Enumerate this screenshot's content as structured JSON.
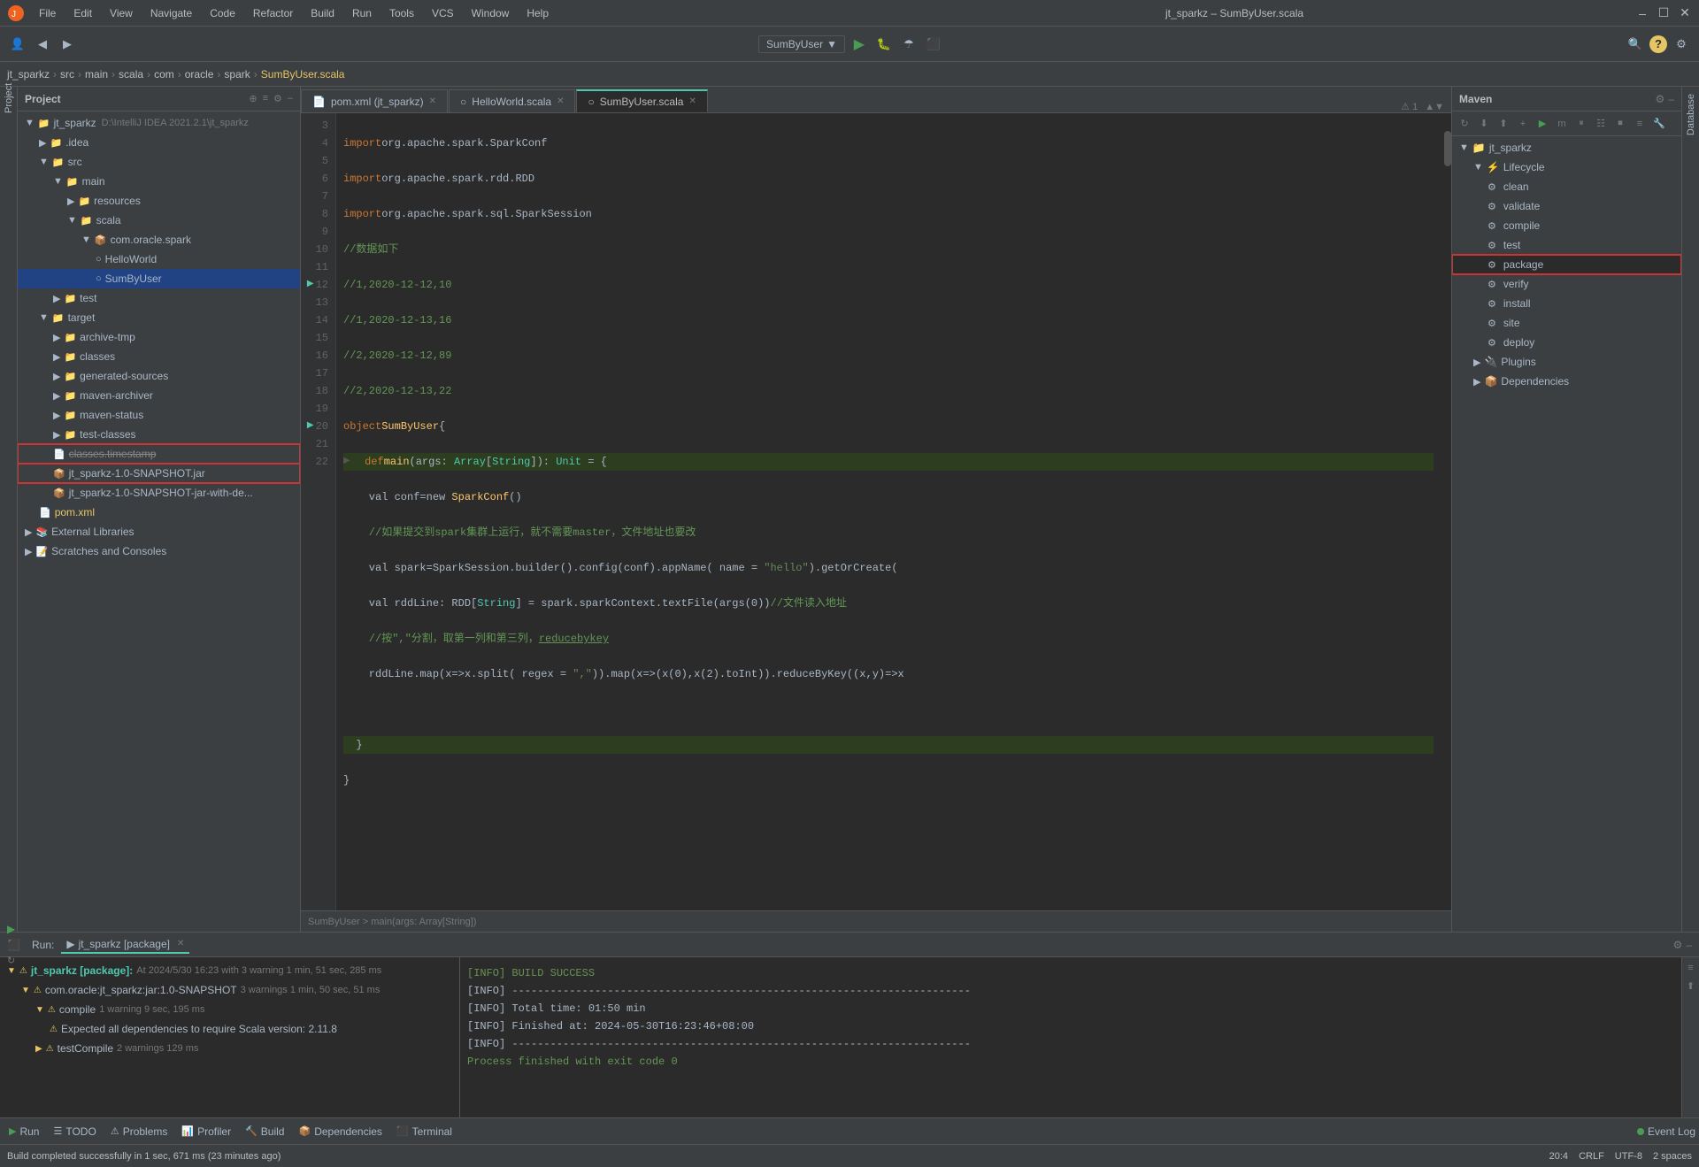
{
  "titlebar": {
    "menus": [
      "File",
      "Edit",
      "View",
      "Navigate",
      "Code",
      "Refactor",
      "Build",
      "Run",
      "Tools",
      "VCS",
      "Window",
      "Help"
    ],
    "title": "jt_sparkz – SumByUser.scala",
    "controls": [
      "–",
      "☐",
      "✕"
    ]
  },
  "breadcrumb": {
    "items": [
      "jt_sparkz",
      "src",
      "main",
      "scala",
      "com",
      "oracle",
      "spark",
      "SumByUser.scala"
    ]
  },
  "toolbar": {
    "profile_label": "SumByUser",
    "run_icon": "▶",
    "debug_icon": "🐛"
  },
  "project": {
    "header": "Project",
    "tree": [
      {
        "indent": 0,
        "icon": "▼",
        "name": "jt_sparkz",
        "extra": "D:\\IntelliJ IDEA 2021.2.1\\jt_sparkz",
        "type": "folder",
        "color": "normal"
      },
      {
        "indent": 1,
        "icon": "▶",
        "name": ".idea",
        "type": "folder",
        "color": "normal"
      },
      {
        "indent": 1,
        "icon": "▼",
        "name": "src",
        "type": "folder",
        "color": "normal"
      },
      {
        "indent": 2,
        "icon": "▼",
        "name": "main",
        "type": "folder",
        "color": "normal"
      },
      {
        "indent": 3,
        "icon": "▶",
        "name": "resources",
        "type": "folder",
        "color": "normal"
      },
      {
        "indent": 3,
        "icon": "▼",
        "name": "scala",
        "type": "folder",
        "color": "normal"
      },
      {
        "indent": 4,
        "icon": "▼",
        "name": "com.oracle.spark",
        "type": "package",
        "color": "normal"
      },
      {
        "indent": 5,
        "icon": "○",
        "name": "HelloWorld",
        "type": "scala",
        "color": "normal"
      },
      {
        "indent": 5,
        "icon": "○",
        "name": "SumByUser",
        "type": "scala",
        "color": "selected"
      },
      {
        "indent": 2,
        "icon": "▶",
        "name": "test",
        "type": "folder",
        "color": "normal"
      },
      {
        "indent": 1,
        "icon": "▼",
        "name": "target",
        "type": "folder",
        "color": "normal"
      },
      {
        "indent": 2,
        "icon": "▶",
        "name": "archive-tmp",
        "type": "folder",
        "color": "normal"
      },
      {
        "indent": 2,
        "icon": "▶",
        "name": "classes",
        "type": "folder",
        "color": "normal"
      },
      {
        "indent": 2,
        "icon": "▶",
        "name": "generated-sources",
        "type": "folder",
        "color": "normal"
      },
      {
        "indent": 2,
        "icon": "▶",
        "name": "maven-archiver",
        "type": "folder",
        "color": "normal"
      },
      {
        "indent": 2,
        "icon": "▶",
        "name": "maven-status",
        "type": "folder",
        "color": "normal"
      },
      {
        "indent": 2,
        "icon": "▶",
        "name": "test-classes",
        "type": "folder",
        "color": "normal"
      },
      {
        "indent": 2,
        "icon": "📄",
        "name": "classes.timestamp",
        "type": "file",
        "color": "strikethrough"
      },
      {
        "indent": 2,
        "icon": "📦",
        "name": "jt_sparkz-1.0-SNAPSHOT.jar",
        "type": "jar",
        "color": "normal",
        "highlight": true
      },
      {
        "indent": 2,
        "icon": "📦",
        "name": "jt_sparkz-1.0-SNAPSHOT-jar-with-de...",
        "type": "jar",
        "color": "normal"
      },
      {
        "indent": 1,
        "icon": "📄",
        "name": "pom.xml",
        "type": "file",
        "color": "normal"
      },
      {
        "indent": 0,
        "icon": "▶",
        "name": "External Libraries",
        "type": "folder",
        "color": "normal"
      },
      {
        "indent": 0,
        "icon": "▶",
        "name": "Scratches and Consoles",
        "type": "folder",
        "color": "normal"
      }
    ]
  },
  "tabs": [
    {
      "name": "pom.xml (jt_sparkz)",
      "active": false,
      "modified": false
    },
    {
      "name": "HelloWorld.scala",
      "active": false,
      "modified": false
    },
    {
      "name": "SumByUser.scala",
      "active": true,
      "modified": false
    }
  ],
  "code": {
    "lines": [
      {
        "num": 3,
        "text": "import org.apache.spark.SparkConf",
        "type": "import"
      },
      {
        "num": 4,
        "text": "import org.apache.spark.rdd.RDD",
        "type": "import"
      },
      {
        "num": 5,
        "text": "import org.apache.spark.sql.SparkSession",
        "type": "import"
      },
      {
        "num": 6,
        "text": "//数据如下",
        "type": "comment"
      },
      {
        "num": 7,
        "text": "//1,2020-12-12,10",
        "type": "comment"
      },
      {
        "num": 8,
        "text": "//1,2020-12-13,16",
        "type": "comment"
      },
      {
        "num": 9,
        "text": "//2,2020-12-12,89",
        "type": "comment"
      },
      {
        "num": 10,
        "text": "//2,2020-12-13,22",
        "type": "comment"
      },
      {
        "num": 11,
        "text": "object SumByUser {",
        "type": "code"
      },
      {
        "num": 12,
        "text": "  def main(args: Array[String]): Unit = {",
        "type": "code",
        "highlight": true
      },
      {
        "num": 13,
        "text": "    val conf=new SparkConf()",
        "type": "code"
      },
      {
        "num": 14,
        "text": "    //如果提交到spark集群上运行，就不需要master，文件地址也要改",
        "type": "comment"
      },
      {
        "num": 15,
        "text": "    val spark=SparkSession.builder().config(conf).appName( name = \"hello\").getOrCreate(",
        "type": "code"
      },
      {
        "num": 16,
        "text": "    val rddLine: RDD[String] = spark.sparkContext.textFile(args(0))//文件读入地址",
        "type": "code"
      },
      {
        "num": 17,
        "text": "    //按\",\"分割，取第一列和第三列，reducebykey",
        "type": "comment"
      },
      {
        "num": 18,
        "text": "    rddLine.map(x=>x.split( regex = \",\")).map(x=>(x(0),x(2).toInt)).reduceByKey((x,y)=>x",
        "type": "code"
      },
      {
        "num": 19,
        "text": "",
        "type": "code"
      },
      {
        "num": 20,
        "text": "  }",
        "type": "code",
        "highlight": true
      },
      {
        "num": 21,
        "text": "}",
        "type": "code"
      },
      {
        "num": 22,
        "text": "",
        "type": "code"
      }
    ]
  },
  "breadcrumb_editor": {
    "text": "SumByUser  >  main(args: Array[String])"
  },
  "maven": {
    "header": "Maven",
    "toolbar_buttons": [
      "↻",
      "⬇",
      "⬆",
      "+",
      "▶",
      "m",
      "⏸",
      "☷",
      "⏹",
      "≡",
      "🔧"
    ],
    "tree": [
      {
        "indent": 0,
        "icon": "▼",
        "name": "jt_sparkz",
        "type": "project"
      },
      {
        "indent": 1,
        "icon": "▼",
        "name": "Lifecycle",
        "type": "folder"
      },
      {
        "indent": 2,
        "icon": "⚙",
        "name": "clean",
        "type": "lifecycle"
      },
      {
        "indent": 2,
        "icon": "⚙",
        "name": "validate",
        "type": "lifecycle"
      },
      {
        "indent": 2,
        "icon": "⚙",
        "name": "compile",
        "type": "lifecycle"
      },
      {
        "indent": 2,
        "icon": "⚙",
        "name": "test",
        "type": "lifecycle"
      },
      {
        "indent": 2,
        "icon": "⚙",
        "name": "package",
        "type": "lifecycle",
        "highlight": true
      },
      {
        "indent": 2,
        "icon": "⚙",
        "name": "verify",
        "type": "lifecycle"
      },
      {
        "indent": 2,
        "icon": "⚙",
        "name": "install",
        "type": "lifecycle"
      },
      {
        "indent": 2,
        "icon": "⚙",
        "name": "site",
        "type": "lifecycle"
      },
      {
        "indent": 2,
        "icon": "⚙",
        "name": "deploy",
        "type": "lifecycle"
      },
      {
        "indent": 1,
        "icon": "▶",
        "name": "Plugins",
        "type": "folder"
      },
      {
        "indent": 1,
        "icon": "▶",
        "name": "Dependencies",
        "type": "folder"
      }
    ]
  },
  "run": {
    "header": "Run:",
    "tab_name": "jt_sparkz [package]",
    "tree": [
      {
        "indent": 0,
        "icon": "▼⚠",
        "name": "jt_sparkz [package]:",
        "extra": "At 2024/5/30 16:23 with 3 warning  1 min, 51 sec, 285 ms",
        "bold": true
      },
      {
        "indent": 1,
        "icon": "▼⚠",
        "name": "com.oracle:jt_sparkz:jar:1.0-SNAPSHOT",
        "extra": "3 warnings   1 min, 50 sec, 51 ms"
      },
      {
        "indent": 2,
        "icon": "▼⚠",
        "name": "compile",
        "extra": "1 warning   9 sec, 195 ms"
      },
      {
        "indent": 3,
        "icon": "⚠",
        "name": "Expected all dependencies to require Scala version: 2.11.8"
      },
      {
        "indent": 2,
        "icon": "▼⚠",
        "name": "testCompile",
        "extra": "2 warnings   129 ms"
      }
    ],
    "output": [
      {
        "text": "[INFO] BUILD SUCCESS",
        "type": "success"
      },
      {
        "text": "[INFO] ------------------------------------------------------------------------",
        "type": "info"
      },
      {
        "text": "[INFO] Total time:  01:50 min",
        "type": "info"
      },
      {
        "text": "[INFO] Finished at: 2024-05-30T16:23:46+08:00",
        "type": "info"
      },
      {
        "text": "[INFO] ------------------------------------------------------------------------",
        "type": "info"
      },
      {
        "text": "",
        "type": "info"
      },
      {
        "text": "Process finished with exit code 0",
        "type": "process"
      }
    ]
  },
  "bottom_tabs": [
    {
      "name": "Run",
      "icon": "▶"
    },
    {
      "name": "TODO",
      "icon": "☰"
    },
    {
      "name": "Problems",
      "icon": "⚠"
    },
    {
      "name": "Profiler",
      "icon": "📊"
    },
    {
      "name": "Build",
      "icon": "🔨"
    },
    {
      "name": "Dependencies",
      "icon": "📦"
    },
    {
      "name": "Terminal",
      "icon": "⬛"
    }
  ],
  "statusbar": {
    "message": "Build completed successfully in 1 sec, 671 ms (23 minutes ago)",
    "line_col": "20:4",
    "line_sep": "CRLF",
    "encoding": "UTF-8",
    "indent": "2 spaces",
    "event_log": "Event Log"
  }
}
